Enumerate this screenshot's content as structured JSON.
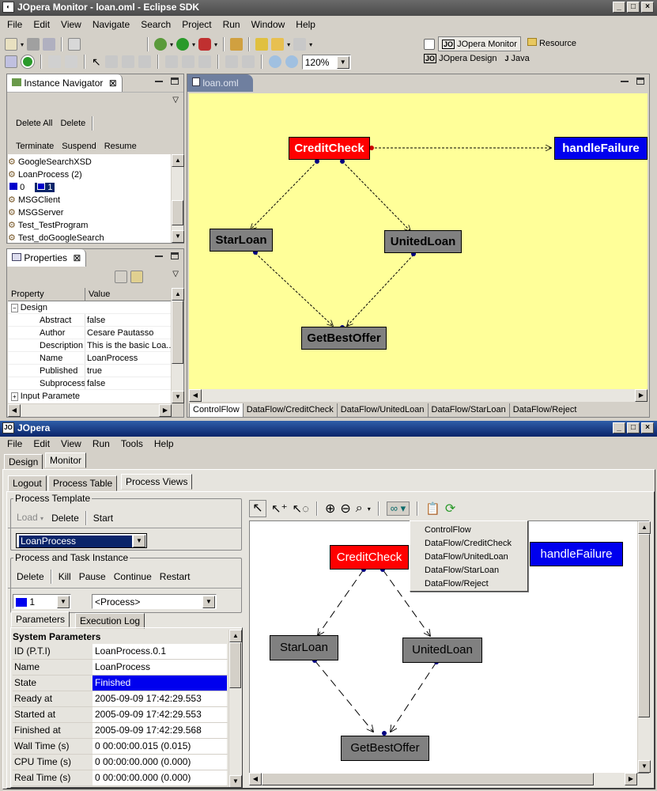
{
  "eclipse": {
    "title": "JOpera Monitor - loan.oml - Eclipse SDK",
    "menu": [
      "File",
      "Edit",
      "View",
      "Navigate",
      "Search",
      "Project",
      "Run",
      "Window",
      "Help"
    ],
    "zoom": "120%",
    "perspectives": {
      "monitor": "JOpera Monitor",
      "resource": "Resource",
      "design": "JOpera Design",
      "java": "Java"
    },
    "navigator": {
      "title": "Instance Navigator",
      "buttons_row1": [
        "Delete All",
        "Delete"
      ],
      "buttons_row2": [
        "Terminate",
        "Suspend",
        "Resume"
      ],
      "items": [
        "GoogleSearchXSD",
        "LoanProcess (2)",
        "0",
        "1",
        "MSGClient",
        "MSGServer",
        "Test_TestProgram",
        "Test_doGoogleSearch"
      ]
    },
    "properties": {
      "title": "Properties",
      "col_property": "Property",
      "col_value": "Value",
      "group": "Design",
      "rows": [
        {
          "k": "Abstract",
          "v": "false"
        },
        {
          "k": "Author",
          "v": "Cesare Pautasso"
        },
        {
          "k": "Description",
          "v": "This is the basic Loa..."
        },
        {
          "k": "Name",
          "v": "LoanProcess"
        },
        {
          "k": "Published",
          "v": "true"
        },
        {
          "k": "Subprocess",
          "v": "false"
        }
      ],
      "group2": "Input Paramete"
    },
    "editor": {
      "tab": "loan.oml",
      "bottom_tabs": [
        "ControlFlow",
        "DataFlow/CreditCheck",
        "DataFlow/UnitedLoan",
        "DataFlow/StarLoan",
        "DataFlow/Reject"
      ],
      "nodes": {
        "credit": "CreditCheck",
        "failure": "handleFailure",
        "star": "StarLoan",
        "united": "UnitedLoan",
        "best": "GetBestOffer"
      },
      "colors": {
        "canvas": "#ffff99",
        "failed": "#ff0000",
        "handler": "#0000ff",
        "done": "#808080"
      }
    }
  },
  "jopera": {
    "title": "JOpera",
    "menu": [
      "File",
      "Edit",
      "View",
      "Run",
      "Tools",
      "Help"
    ],
    "top_tabs": [
      "Design",
      "Monitor"
    ],
    "sub_tabs": [
      "Logout",
      "Process Table",
      "Process Views"
    ],
    "template_group": {
      "label": "Process Template",
      "load": "Load",
      "delete": "Delete",
      "start": "Start",
      "selected": "LoanProcess"
    },
    "instance_group": {
      "label": "Process and Task Instance",
      "buttons": [
        "Delete",
        "Kill",
        "Pause",
        "Continue",
        "Restart"
      ],
      "instance": "1",
      "task": "<Process>"
    },
    "param_tabs": [
      "Parameters",
      "Execution Log"
    ],
    "params_header": "System Parameters",
    "params": [
      {
        "k": "ID (P.T.I)",
        "v": "LoanProcess.0.1"
      },
      {
        "k": "Name",
        "v": "LoanProcess"
      },
      {
        "k": "State",
        "v": "Finished"
      },
      {
        "k": "Ready at",
        "v": "2005-09-09 17:42:29.553"
      },
      {
        "k": "Started at",
        "v": "2005-09-09 17:42:29.553"
      },
      {
        "k": "Finished at",
        "v": "2005-09-09 17:42:29.568"
      },
      {
        "k": "Wall Time (s)",
        "v": "0 00:00:00.015 (0.015)"
      },
      {
        "k": "CPU Time (s)",
        "v": "0 00:00:00.000 (0.000)"
      },
      {
        "k": "Real Time (s)",
        "v": "0 00:00:00.000 (0.000)"
      }
    ],
    "view_menu": [
      "ControlFlow",
      "DataFlow/CreditCheck",
      "DataFlow/UnitedLoan",
      "DataFlow/StarLoan",
      "DataFlow/Reject"
    ],
    "nodes": {
      "credit": "CreditCheck",
      "failure": "handleFailure",
      "star": "StarLoan",
      "united": "UnitedLoan",
      "best": "GetBestOffer"
    }
  }
}
